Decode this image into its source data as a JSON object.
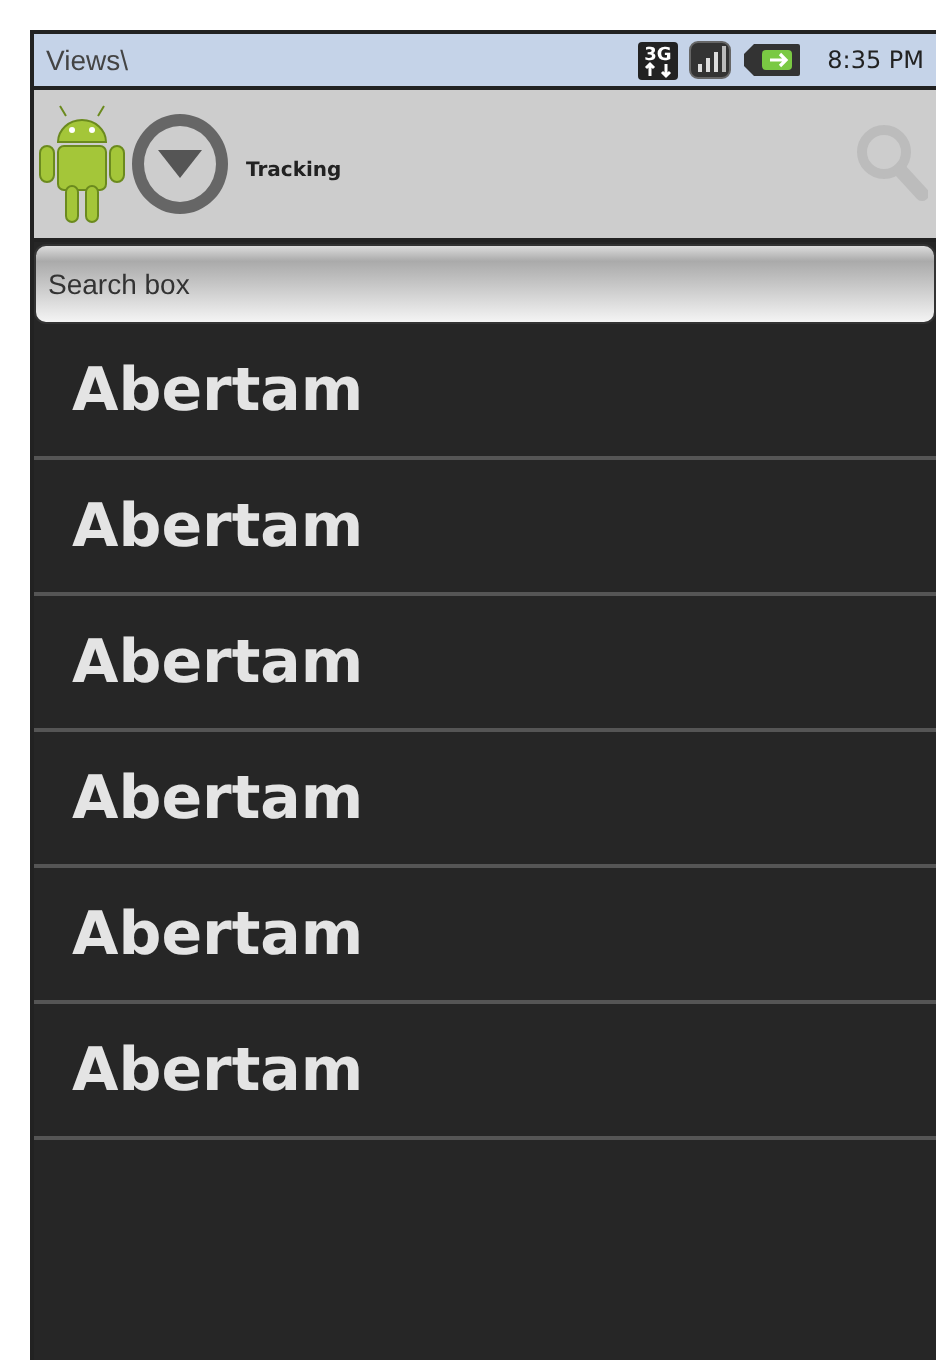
{
  "status_bar": {
    "title": "Views\\",
    "network": "3G",
    "time": "8:35 PM"
  },
  "toolbar": {
    "label": "Tracking"
  },
  "search": {
    "placeholder": "Search box"
  },
  "list": [
    {
      "label": "Abertam"
    },
    {
      "label": "Abertam"
    },
    {
      "label": "Abertam"
    },
    {
      "label": "Abertam"
    },
    {
      "label": "Abertam"
    },
    {
      "label": "Abertam"
    }
  ]
}
